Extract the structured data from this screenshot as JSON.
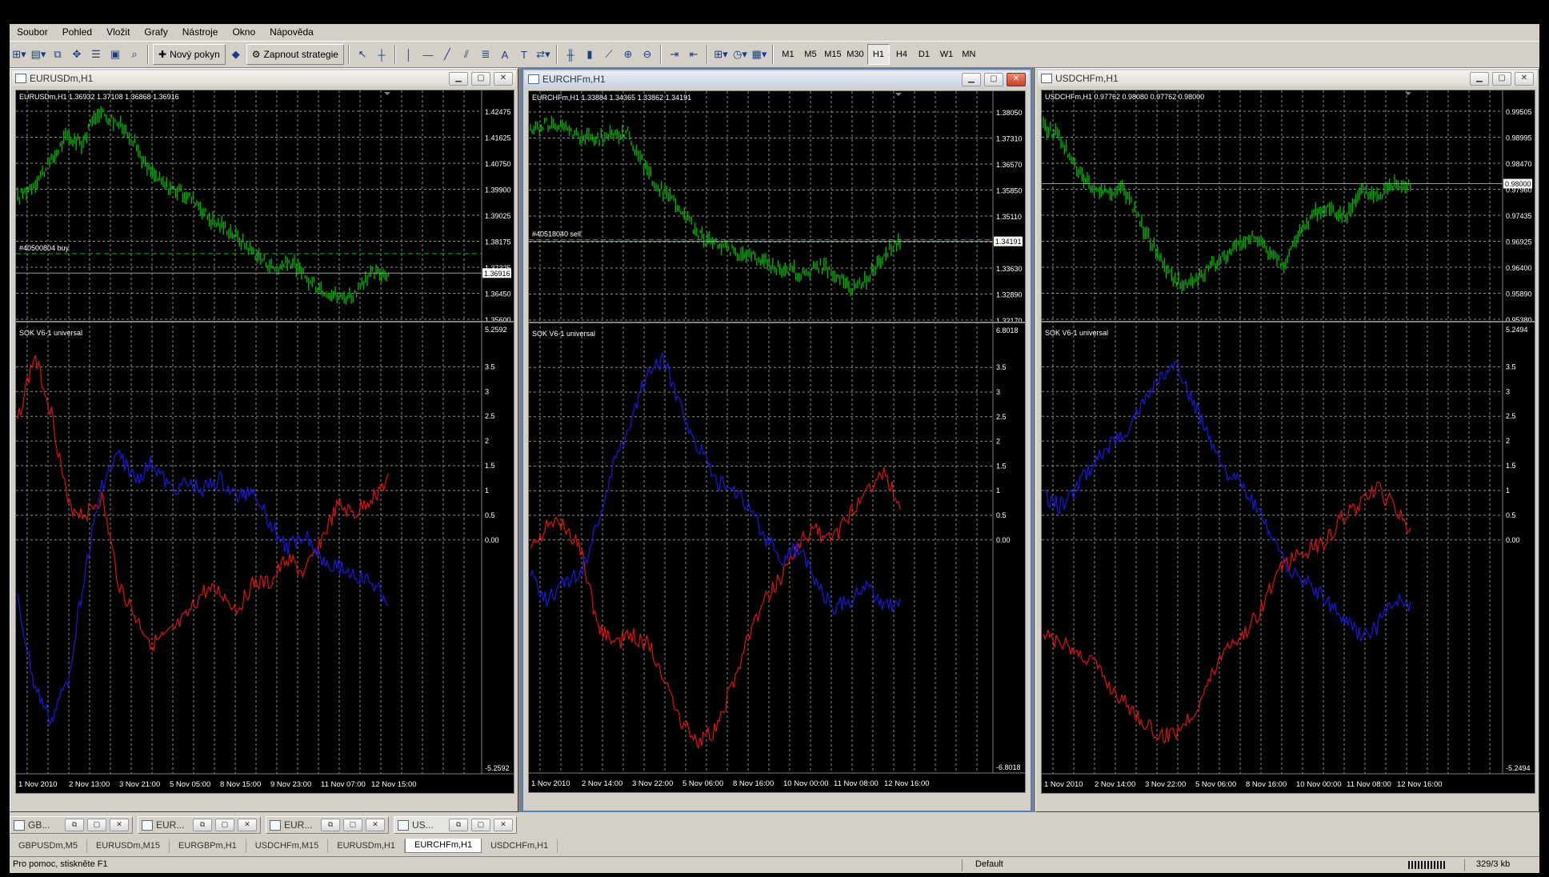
{
  "menu": [
    "Soubor",
    "Pohled",
    "Vložit",
    "Grafy",
    "Nástroje",
    "Okno",
    "Nápověda"
  ],
  "toolbar": {
    "new_order": "Nový pokyn",
    "strategies": "Zapnout strategie",
    "timeframes": [
      "M1",
      "M5",
      "M15",
      "M30",
      "H1",
      "H4",
      "D1",
      "W1",
      "MN"
    ],
    "active_timeframe": "H1"
  },
  "windows": [
    {
      "title": "EURUSDm,H1",
      "info": "EURUSDm,H1  1.36932 1.37108 1.36868 1.36916",
      "price_labels": [
        "1.42475",
        "1.41625",
        "1.40750",
        "1.39900",
        "1.39025",
        "1.38175",
        "1.37325",
        "1.36450",
        "1.35600"
      ],
      "current_price": "1.36916",
      "order_label": "#40500804 buy",
      "indicator": "SOK V6-1 universal",
      "ind_max": "5.2592",
      "ind_min": "-5.2592",
      "ind_levels": [
        "3.5",
        "3",
        "2.5",
        "2",
        "1.5",
        "1",
        "0.5",
        "0.00"
      ],
      "dates": [
        "1 Nov 2010",
        "2 Nov 13:00",
        "3 Nov 21:00",
        "5 Nov 05:00",
        "8 Nov 15:00",
        "9 Nov 23:00",
        "11 Nov 07:00",
        "12 Nov 15:00"
      ]
    },
    {
      "title": "EURCHFm,H1",
      "info": "EURCHFm,H1  1.33884 1.34365 1.33862 1.34191",
      "price_labels": [
        "1.38050",
        "1.37310",
        "1.36570",
        "1.35850",
        "1.35110",
        "1.34370",
        "1.33630",
        "1.32890",
        "1.32170"
      ],
      "current_price": "1.34191",
      "order_label": "#40518040 sell",
      "indicator": "SOK V6-1 universal",
      "ind_max": "6.8018",
      "ind_min": "-6.8018",
      "ind_levels": [
        "3.5",
        "3",
        "2.5",
        "2",
        "1.5",
        "1",
        "0.5",
        "0.00"
      ],
      "dates": [
        "1 Nov 2010",
        "2 Nov 14:00",
        "3 Nov 22:00",
        "5 Nov 06:00",
        "8 Nov 16:00",
        "10 Nov 00:00",
        "11 Nov 08:00",
        "12 Nov 16:00"
      ]
    },
    {
      "title": "USDCHFm,H1",
      "info": "USDCHFm,H1  0.97762 0.98080 0.97762 0.98000",
      "price_labels": [
        "0.99505",
        "0.98995",
        "0.98470",
        "0.97960",
        "0.97435",
        "0.96925",
        "0.96400",
        "0.95890",
        "0.95380"
      ],
      "current_price": "0.98000",
      "order_label": "",
      "indicator": "SOK V6-1 universal",
      "ind_max": "5.2494",
      "ind_min": "-5.2494",
      "ind_levels": [
        "3.5",
        "3",
        "2.5",
        "2",
        "1.5",
        "1",
        "0.5",
        "0.00"
      ],
      "dates": [
        "1 Nov 2010",
        "2 Nov 14:00",
        "3 Nov 22:00",
        "5 Nov 06:00",
        "8 Nov 16:00",
        "10 Nov 00:00",
        "11 Nov 08:00",
        "12 Nov 16:00"
      ]
    }
  ],
  "tasks": [
    "GB...",
    "EUR...",
    "EUR...",
    "US..."
  ],
  "chart_tabs": [
    "GBPUSDm,M5",
    "EURUSDm,M15",
    "EURGBPm,H1",
    "USDCHFm,M15",
    "EURUSDm,H1",
    "EURCHFm,H1",
    "USDCHFm,H1"
  ],
  "selected_tab": "EURCHFm,H1",
  "status": {
    "help": "Pro pomoc, stiskněte F1",
    "profile": "Default",
    "traffic": "329/3 kb"
  },
  "colors": {
    "candles": "#00b000",
    "ind_red": "#e01010",
    "ind_blue": "#1818e0",
    "grid": "#8a8a8a"
  }
}
